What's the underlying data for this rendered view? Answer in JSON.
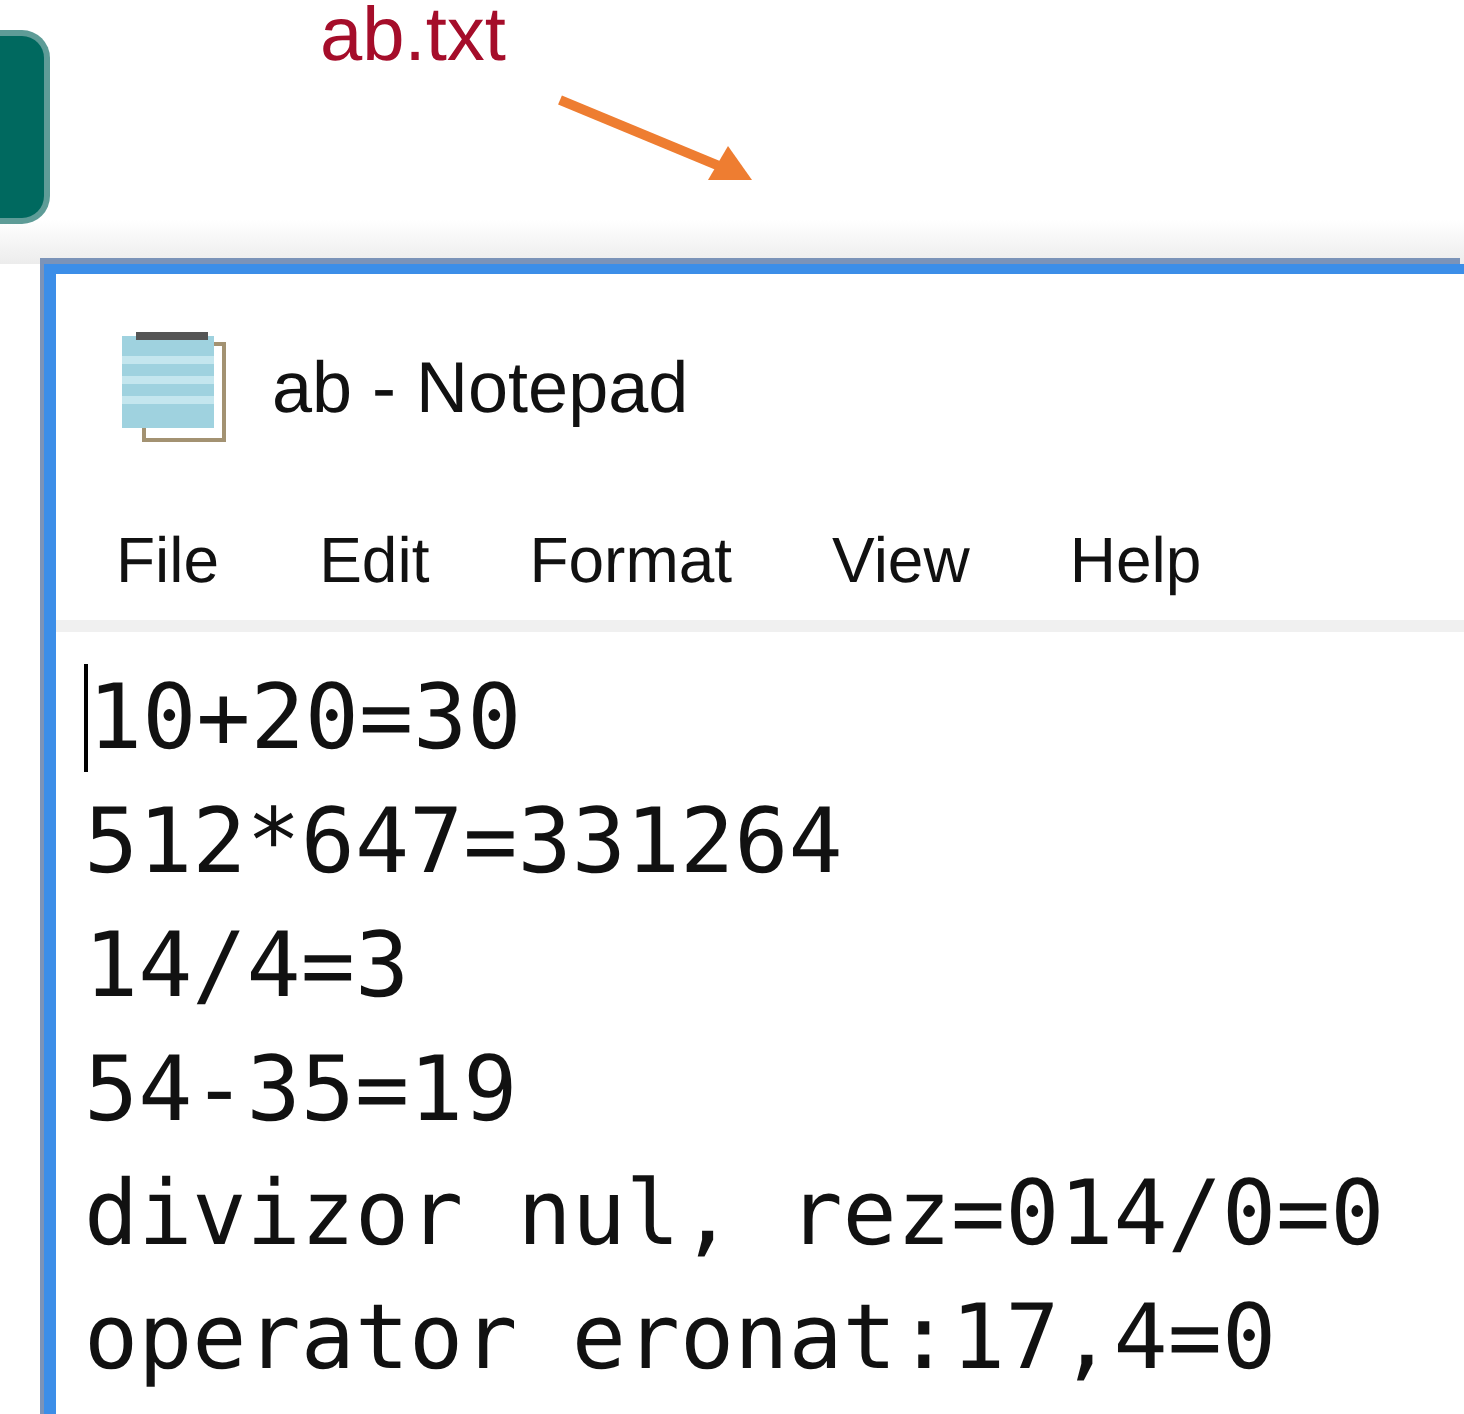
{
  "annotation": {
    "label": "ab.txt"
  },
  "window": {
    "title": "ab - Notepad"
  },
  "menu": [
    "File",
    "Edit",
    "Format",
    "View",
    "Help"
  ],
  "editor": {
    "lines": [
      "10+20=30",
      "512*647=331264",
      "14/4=3",
      "54-35=19",
      "divizor nul, rez=014/0=0",
      "operator eronat:17,4=0"
    ]
  }
}
